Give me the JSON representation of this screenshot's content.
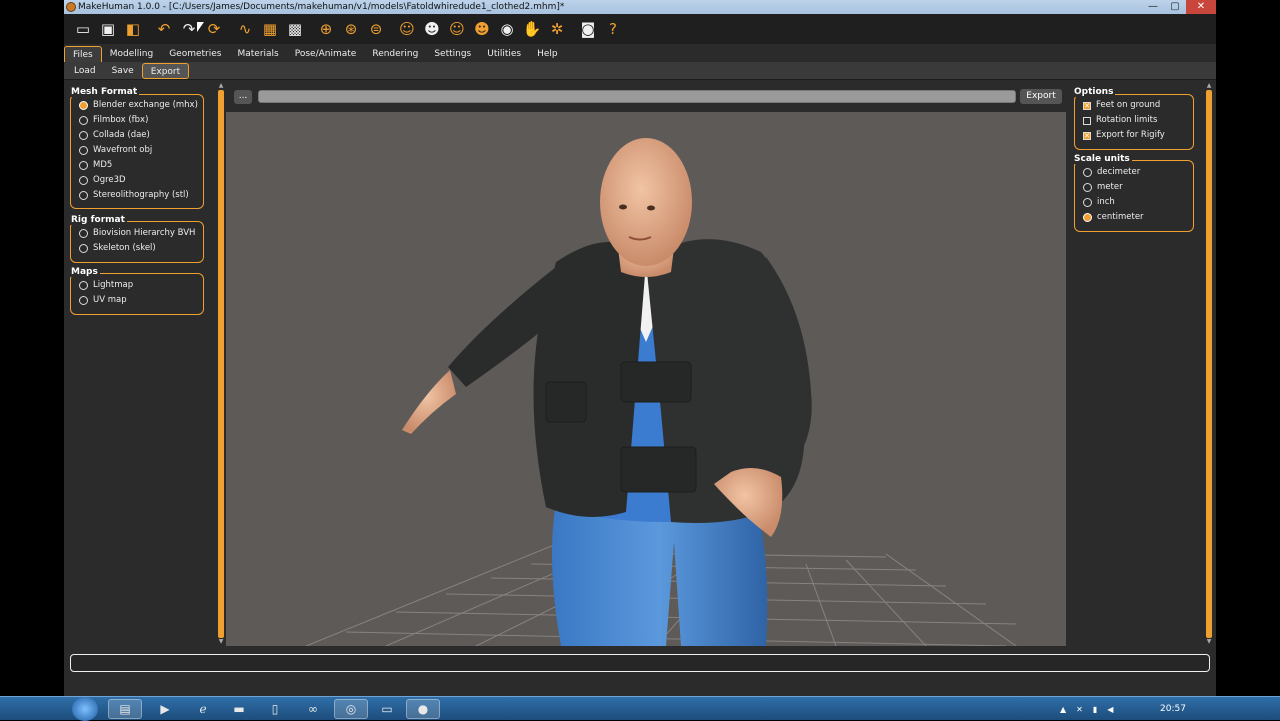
{
  "window": {
    "title": "MakeHuman 1.0.0 - [C:/Users/James/Documents/makehuman/v1/models\\Fatoldwhiredude1_clothed2.mhm]*",
    "min": "—",
    "max": "▢",
    "close": "✕"
  },
  "toolbar": {
    "icons": [
      "file-icon",
      "save-icon",
      "export-icon",
      "undo-icon",
      "redo-icon",
      "reset-icon",
      "smooth-icon",
      "wireframe-icon",
      "background-icon",
      "front-view-icon",
      "side-view-icon",
      "top-view-icon",
      "head-icon",
      "head-side-icon",
      "head-back-icon",
      "head-top-icon",
      "hair-icon",
      "hands-icon",
      "skeleton-icon",
      "screenshot-icon",
      "help-icon"
    ]
  },
  "menu": {
    "tabs": [
      "Files",
      "Modelling",
      "Geometries",
      "Materials",
      "Pose/Animate",
      "Rendering",
      "Settings",
      "Utilities",
      "Help"
    ],
    "active": "Files"
  },
  "submenu": {
    "tabs": [
      "Load",
      "Save",
      "Export"
    ],
    "active": "Export"
  },
  "mesh_format": {
    "title": "Mesh Format",
    "options": [
      {
        "label": "Blender exchange (mhx)",
        "selected": true
      },
      {
        "label": "Filmbox (fbx)",
        "selected": false
      },
      {
        "label": "Collada (dae)",
        "selected": false
      },
      {
        "label": "Wavefront obj",
        "selected": false
      },
      {
        "label": "MD5",
        "selected": false
      },
      {
        "label": "Ogre3D",
        "selected": false
      },
      {
        "label": "Stereolithography (stl)",
        "selected": false
      }
    ]
  },
  "rig_format": {
    "title": "Rig format",
    "options": [
      {
        "label": "Biovision Hierarchy BVH",
        "selected": false
      },
      {
        "label": "Skeleton (skel)",
        "selected": false
      }
    ]
  },
  "maps": {
    "title": "Maps",
    "options": [
      {
        "label": "Lightmap",
        "selected": false
      },
      {
        "label": "UV map",
        "selected": false
      }
    ]
  },
  "options": {
    "title": "Options",
    "items": [
      {
        "label": "Feet on ground",
        "checked": true
      },
      {
        "label": "Rotation limits",
        "checked": false
      },
      {
        "label": "Export for Rigify",
        "checked": true
      }
    ]
  },
  "scale_units": {
    "title": "Scale units",
    "options": [
      {
        "label": "decimeter",
        "selected": false
      },
      {
        "label": "meter",
        "selected": false
      },
      {
        "label": "inch",
        "selected": false
      },
      {
        "label": "centimeter",
        "selected": true
      }
    ]
  },
  "export": {
    "browse_label": "...",
    "path_value": "",
    "button_label": "Export"
  },
  "taskbar": {
    "clock": "20:57"
  }
}
